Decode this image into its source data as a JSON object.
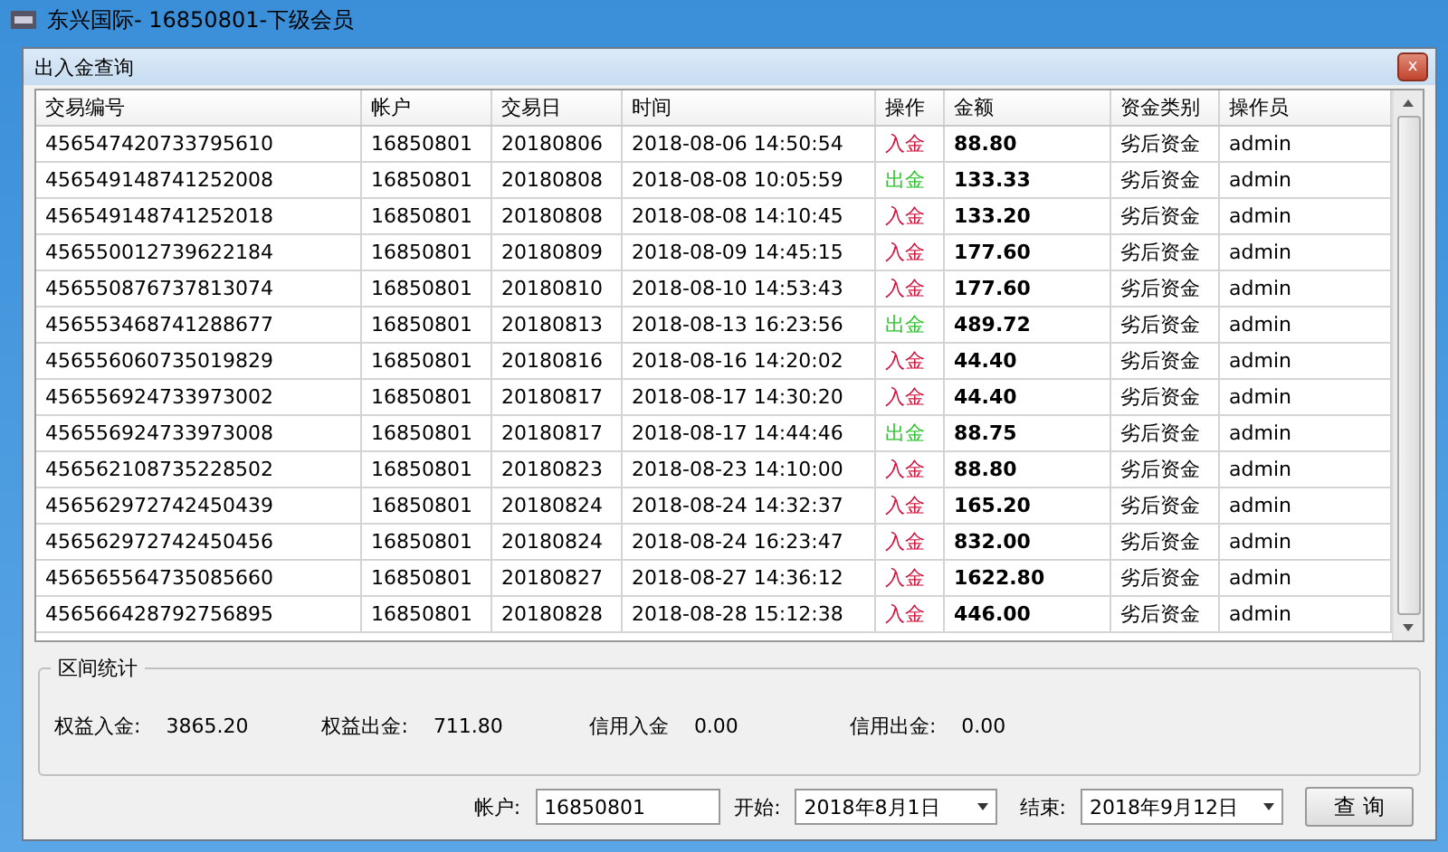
{
  "window": {
    "title": "东兴国际- 16850801-下级会员"
  },
  "dialog": {
    "title": "出入金查询",
    "close": "x"
  },
  "table": {
    "columns": [
      "交易编号",
      "帐户",
      "交易日",
      "时间",
      "操作",
      "金额",
      "资金类别",
      "操作员"
    ],
    "rows": [
      {
        "id": "456547420733795610",
        "account": "16850801",
        "trade_date": "20180806",
        "time": "2018-08-06 14:50:54",
        "op": "入金",
        "kind": "in",
        "amount": "88.80",
        "fund_type": "劣后资金",
        "operator": "admin"
      },
      {
        "id": "456549148741252008",
        "account": "16850801",
        "trade_date": "20180808",
        "time": "2018-08-08 10:05:59",
        "op": "出金",
        "kind": "out",
        "amount": "133.33",
        "fund_type": "劣后资金",
        "operator": "admin"
      },
      {
        "id": "456549148741252018",
        "account": "16850801",
        "trade_date": "20180808",
        "time": "2018-08-08 14:10:45",
        "op": "入金",
        "kind": "in",
        "amount": "133.20",
        "fund_type": "劣后资金",
        "operator": "admin"
      },
      {
        "id": "456550012739622184",
        "account": "16850801",
        "trade_date": "20180809",
        "time": "2018-08-09 14:45:15",
        "op": "入金",
        "kind": "in",
        "amount": "177.60",
        "fund_type": "劣后资金",
        "operator": "admin"
      },
      {
        "id": "456550876737813074",
        "account": "16850801",
        "trade_date": "20180810",
        "time": "2018-08-10 14:53:43",
        "op": "入金",
        "kind": "in",
        "amount": "177.60",
        "fund_type": "劣后资金",
        "operator": "admin"
      },
      {
        "id": "456553468741288677",
        "account": "16850801",
        "trade_date": "20180813",
        "time": "2018-08-13 16:23:56",
        "op": "出金",
        "kind": "out",
        "amount": "489.72",
        "fund_type": "劣后资金",
        "operator": "admin"
      },
      {
        "id": "456556060735019829",
        "account": "16850801",
        "trade_date": "20180816",
        "time": "2018-08-16 14:20:02",
        "op": "入金",
        "kind": "in",
        "amount": "44.40",
        "fund_type": "劣后资金",
        "operator": "admin"
      },
      {
        "id": "456556924733973002",
        "account": "16850801",
        "trade_date": "20180817",
        "time": "2018-08-17 14:30:20",
        "op": "入金",
        "kind": "in",
        "amount": "44.40",
        "fund_type": "劣后资金",
        "operator": "admin"
      },
      {
        "id": "456556924733973008",
        "account": "16850801",
        "trade_date": "20180817",
        "time": "2018-08-17 14:44:46",
        "op": "出金",
        "kind": "out",
        "amount": "88.75",
        "fund_type": "劣后资金",
        "operator": "admin"
      },
      {
        "id": "456562108735228502",
        "account": "16850801",
        "trade_date": "20180823",
        "time": "2018-08-23 14:10:00",
        "op": "入金",
        "kind": "in",
        "amount": "88.80",
        "fund_type": "劣后资金",
        "operator": "admin"
      },
      {
        "id": "456562972742450439",
        "account": "16850801",
        "trade_date": "20180824",
        "time": "2018-08-24 14:32:37",
        "op": "入金",
        "kind": "in",
        "amount": "165.20",
        "fund_type": "劣后资金",
        "operator": "admin"
      },
      {
        "id": "456562972742450456",
        "account": "16850801",
        "trade_date": "20180824",
        "time": "2018-08-24 16:23:47",
        "op": "入金",
        "kind": "in",
        "amount": "832.00",
        "fund_type": "劣后资金",
        "operator": "admin"
      },
      {
        "id": "456565564735085660",
        "account": "16850801",
        "trade_date": "20180827",
        "time": "2018-08-27 14:36:12",
        "op": "入金",
        "kind": "in",
        "amount": "1622.80",
        "fund_type": "劣后资金",
        "operator": "admin"
      },
      {
        "id": "456566428792756895",
        "account": "16850801",
        "trade_date": "20180828",
        "time": "2018-08-28 15:12:38",
        "op": "入金",
        "kind": "in",
        "amount": "446.00",
        "fund_type": "劣后资金",
        "operator": "admin"
      }
    ]
  },
  "stats": {
    "title": "区间统计",
    "items": [
      {
        "label": "权益入金:",
        "value": "3865.20"
      },
      {
        "label": "权益出金:",
        "value": "711.80"
      },
      {
        "label": "信用入金",
        "value": "0.00"
      },
      {
        "label": "信用出金:",
        "value": "0.00"
      }
    ]
  },
  "filter": {
    "account_label": "帐户:",
    "account": "16850801",
    "start_label": "开始:",
    "start": "2018年8月1日",
    "end_label": "结束:",
    "end": "2018年9月12日",
    "button": "查 询"
  }
}
